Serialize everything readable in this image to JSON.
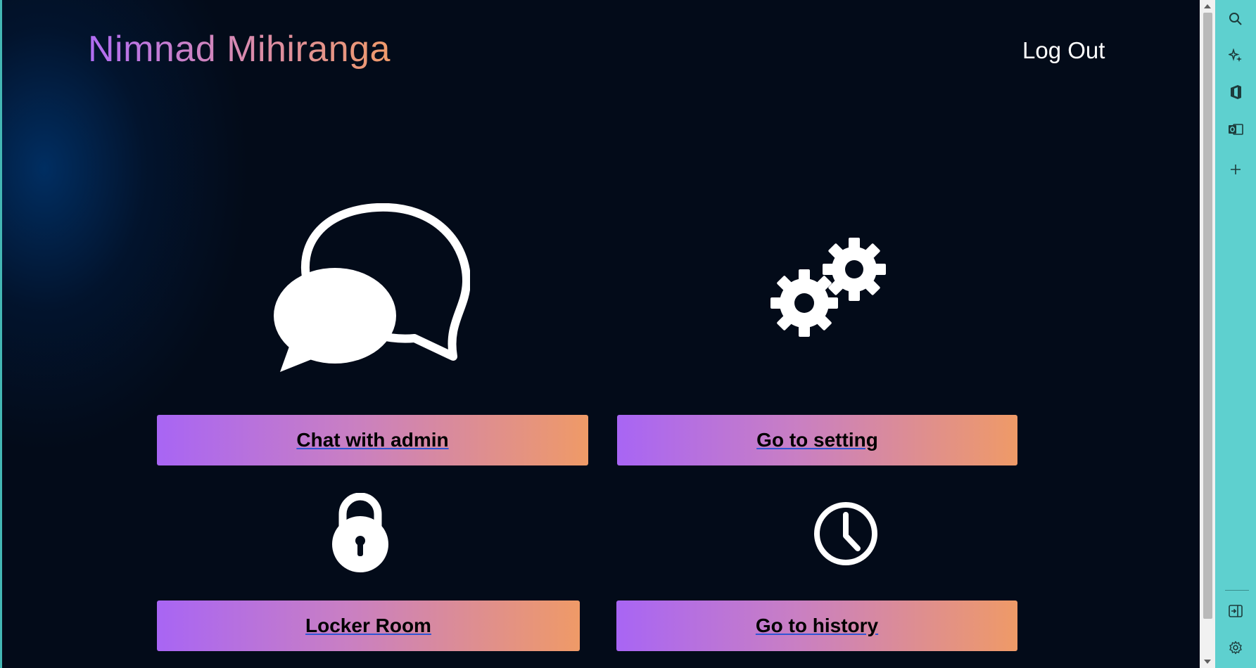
{
  "header": {
    "brand": "Nimnad Mihiranga",
    "logout_label": "Log Out"
  },
  "cards": [
    {
      "icon": "chat-bubbles-icon",
      "label": "Chat with admin"
    },
    {
      "icon": "gears-icon",
      "label": "Go to setting"
    },
    {
      "icon": "padlock-icon",
      "label": "Locker Room"
    },
    {
      "icon": "clock-icon",
      "label": "Go to history"
    }
  ],
  "sidebar_rail": {
    "items": [
      "search-icon",
      "sparkle-icon",
      "office-icon",
      "outlook-icon",
      "plus-icon",
      "split-screen-icon",
      "settings-icon"
    ]
  },
  "colors": {
    "background": "#030b19",
    "button_gradient_start": "#a865f4",
    "button_gradient_end": "#ef9a67",
    "rail": "#5ed0cf"
  }
}
